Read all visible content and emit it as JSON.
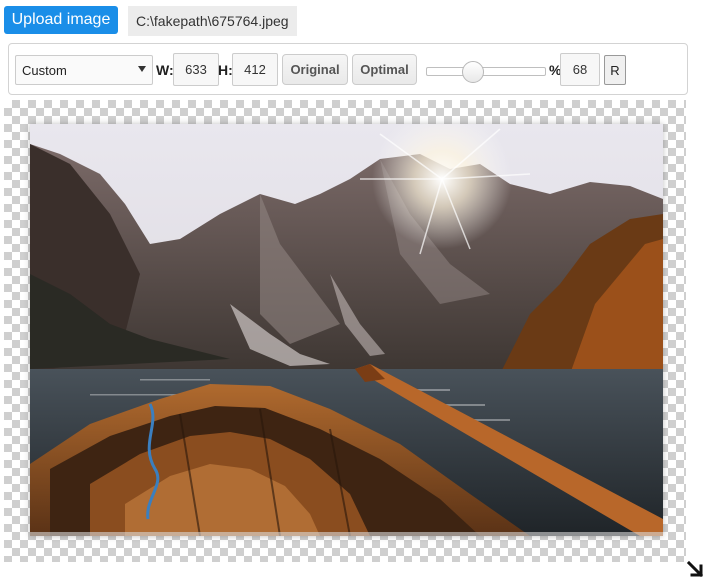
{
  "upload": {
    "label": "Upload image"
  },
  "file": {
    "path": "C:\\fakepath\\675764.jpeg"
  },
  "toolbar": {
    "preset": "Custom",
    "width_label": "W:",
    "width_value": "633",
    "height_label": "H:",
    "height_value": "412",
    "original_label": "Original",
    "optimal_label": "Optimal",
    "percent_label": "%",
    "percent_value": "68",
    "reset_label": "R"
  },
  "colors": {
    "upload_button": "#1a8ee8",
    "checker": "#cfcfcf"
  }
}
